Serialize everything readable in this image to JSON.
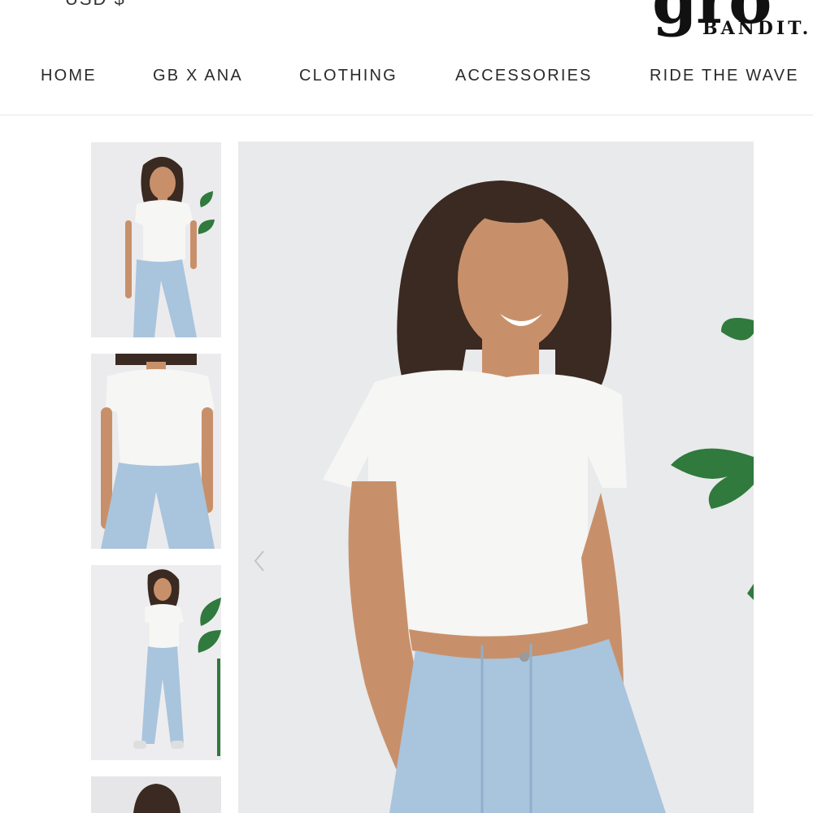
{
  "header": {
    "currency": "USD $",
    "logo": {
      "mark": "gro",
      "text": "BANDIT."
    }
  },
  "nav": {
    "items": [
      {
        "label": "HOME"
      },
      {
        "label": "GB X ANA"
      },
      {
        "label": "CLOTHING"
      },
      {
        "label": "ACCESSORIES"
      },
      {
        "label": "RIDE THE WAVE"
      }
    ]
  },
  "gallery": {
    "thumbnails": [
      {
        "icon": "model-front-photo"
      },
      {
        "icon": "model-closeup-photo"
      },
      {
        "icon": "model-fullbody-photo"
      },
      {
        "icon": "model-back-photo"
      }
    ],
    "main_image": {
      "icon": "model-main-photo"
    },
    "prev_arrow": {
      "icon": "chevron-left-icon"
    },
    "colors": {
      "background": "#e9eaec",
      "shirt": "#f6f6f4",
      "jeans": "#a9c4dd",
      "hair": "#3a2a22",
      "skin": "#c8906a",
      "leaf": "#2f7a3c"
    }
  }
}
